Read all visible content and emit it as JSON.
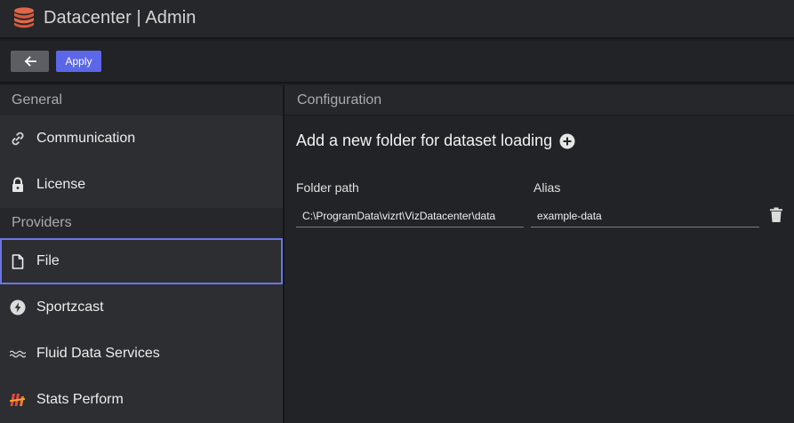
{
  "app": {
    "title": "Datacenter | Admin",
    "logo_icon": "database-icon",
    "logo_color": "#e0674a"
  },
  "toolbar": {
    "back_icon": "arrow-left-icon",
    "apply_label": "Apply",
    "apply_color": "#5b66e8"
  },
  "sidebar": {
    "sections": [
      {
        "header": "General",
        "items": [
          {
            "label": "Communication",
            "icon": "link-icon"
          },
          {
            "label": "License",
            "icon": "lock-icon"
          }
        ]
      },
      {
        "header": "Providers",
        "items": [
          {
            "label": "File",
            "icon": "file-icon",
            "active": true
          },
          {
            "label": "Sportzcast",
            "icon": "bolt-circle-icon"
          },
          {
            "label": "Fluid Data Services",
            "icon": "waves-icon"
          },
          {
            "label": "Stats Perform",
            "icon": "stats-perform-logo-icon"
          }
        ]
      }
    ]
  },
  "main": {
    "header": "Configuration",
    "add_folder_label": "Add a new folder for dataset loading",
    "add_icon": "plus-circle-icon",
    "folder_path_label": "Folder path",
    "alias_label": "Alias",
    "rows": [
      {
        "folder_path": "C:\\ProgramData\\vizrt\\VizDatacenter\\data",
        "alias": "example-data",
        "delete_icon": "trash-icon"
      }
    ]
  }
}
